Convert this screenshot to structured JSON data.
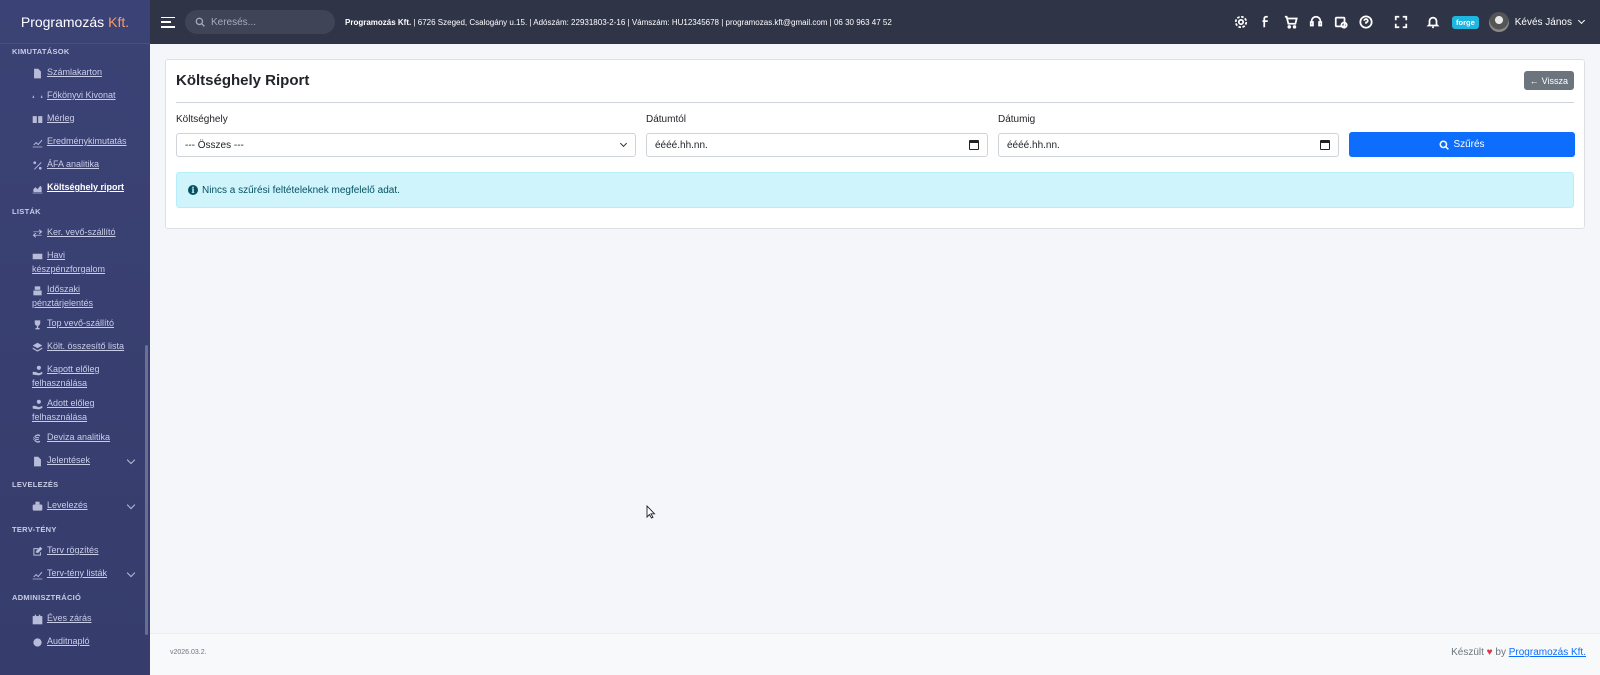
{
  "brand": {
    "name": "Programozás",
    "accent": "Kft."
  },
  "sidebar": {
    "sections": [
      {
        "title": "KIMUTATÁSOK",
        "items": [
          {
            "label": "Számlakarton",
            "icon": "file-icon"
          },
          {
            "label": "Főkönyvi Kivonat",
            "icon": "scale-icon"
          },
          {
            "label": "Mérleg",
            "icon": "book-icon"
          },
          {
            "label": "Eredménykimutatás",
            "icon": "chart-line-icon"
          },
          {
            "label": "ÁFA analitika",
            "icon": "percent-icon"
          },
          {
            "label": "Költséghely riport",
            "icon": "chart-area-icon",
            "active": true
          }
        ]
      },
      {
        "title": "LISTÁK",
        "items": [
          {
            "label": "Ker. vevő-szállító",
            "icon": "exchange-icon"
          },
          {
            "label": "Havi készpénzforgalom",
            "icon": "money-icon"
          },
          {
            "label": "Időszaki pénztárjelentés",
            "icon": "cash-register-icon"
          },
          {
            "label": "Top vevő-szállító",
            "icon": "trophy-icon"
          },
          {
            "label": "Költ. összesítő lista",
            "icon": "layers-icon"
          },
          {
            "label": "Kapott előleg felhasználása",
            "icon": "hand-coin-icon"
          },
          {
            "label": "Adott előleg felhasználása",
            "icon": "hand-coin-icon"
          },
          {
            "label": "Deviza analitika",
            "icon": "euro-icon"
          },
          {
            "label": "Jelentések",
            "icon": "report-icon",
            "expandable": true
          }
        ]
      },
      {
        "title": "LEVELEZÉS",
        "items": [
          {
            "label": "Levelezés",
            "icon": "mailbox-icon",
            "expandable": true
          }
        ]
      },
      {
        "title": "TERV-TÉNY",
        "items": [
          {
            "label": "Terv rögzítés",
            "icon": "edit-icon"
          },
          {
            "label": "Terv-tény listák",
            "icon": "chart-line-icon",
            "expandable": true
          }
        ]
      },
      {
        "title": "ADMINISZTRÁCIÓ",
        "items": [
          {
            "label": "Éves zárás",
            "icon": "calendar-check-icon"
          },
          {
            "label": "Auditnapló",
            "icon": "history-icon"
          }
        ]
      }
    ]
  },
  "topbar": {
    "search_placeholder": "Keresés...",
    "company_name": "Programozás Kft.",
    "company_details": " | 6726 Szeged, Csalogány u.15.  |  Adószám: 22931803-2-16  |  Vámszám: HU12345678  |  programozas.kft@gmail.com  |  06 30 963 47 52",
    "badge": "forge",
    "user_name": "Kévés János"
  },
  "page": {
    "title": "Költséghely Riport",
    "back_label": "Vissza",
    "filters": {
      "cost_center_label": "Költséghely",
      "cost_center_value": "--- Összes ---",
      "date_from_label": "Dátumtól",
      "date_from_value": "éééé.hh.nn.",
      "date_to_label": "Dátumig",
      "date_to_value": "éééé.hh.nn.",
      "filter_button": "Szűrés"
    },
    "alert": "Nincs a szűrési feltételeknek megfelelő adat."
  },
  "footer": {
    "version": "v2026.03.2.",
    "made_prefix": "Készült",
    "made_by": "by",
    "made_link": "Programozás Kft."
  },
  "colors": {
    "sidebar": "#363d6c",
    "topbar": "#2f3447",
    "primary": "#0d6efd",
    "info_bg": "#cff4fc",
    "accent": "#f39c6b"
  }
}
